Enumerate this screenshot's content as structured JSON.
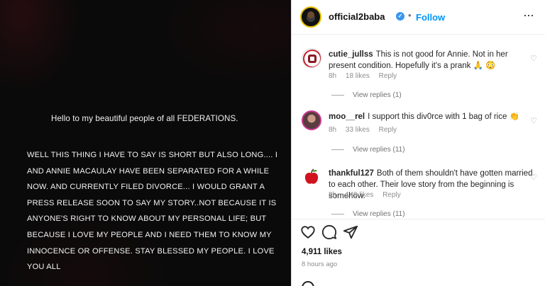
{
  "story": {
    "greeting": "Hello to my beautiful people of all FEDERATIONS.",
    "message": "WELL THIS THING I HAVE TO SAY IS SHORT BUT ALSO LONG.... I AND ANNIE MACAULAY HAVE BEEN SEPARATED FOR A WHILE NOW. AND CURRENTLY FILED DIVORCE... I WOULD GRANT A PRESS RELEASE SOON TO SAY MY STORY..NOT BECAUSE IT IS ANYONE'S RIGHT TO KNOW ABOUT MY PERSONAL LIFE; BUT BECAUSE I LOVE MY PEOPLE AND I NEED THEM TO KNOW MY INNOCENCE OR OFFENSE. STAY BLESSED MY PEOPLE. I LOVE YOU ALL"
  },
  "header": {
    "username": "official2baba",
    "dot": "•",
    "follow": "Follow"
  },
  "comments": [
    {
      "username": "cutie_jullss",
      "text": "This is not good for Annie. Not in her present condition. Hopefully it's a prank 🙏 😳",
      "time": "8h",
      "likes": "18 likes",
      "reply": "Reply",
      "view_replies": "View replies (1)"
    },
    {
      "username": "moo__rel",
      "text": "I support this div0rce with 1 bag of rice 👏",
      "time": "8h",
      "likes": "33 likes",
      "reply": "Reply",
      "view_replies": "View replies (11)"
    },
    {
      "username": "thankful127",
      "text": "Both of them shouldn't have gotten married to each other. Their love story from the beginning is somehow.",
      "time": "8h",
      "likes": "149 likes",
      "reply": "Reply",
      "view_replies": "View replies (11)"
    }
  ],
  "footer": {
    "likes": "4,911 likes",
    "time": "8 hours ago"
  },
  "icons": {
    "like": "heart-icon",
    "comment": "comment-icon",
    "share": "share-icon",
    "comment_like": "heart-outline-icon",
    "more": "more-icon"
  },
  "colors": {
    "accent": "#0095f6",
    "verified": "#3897f0"
  }
}
